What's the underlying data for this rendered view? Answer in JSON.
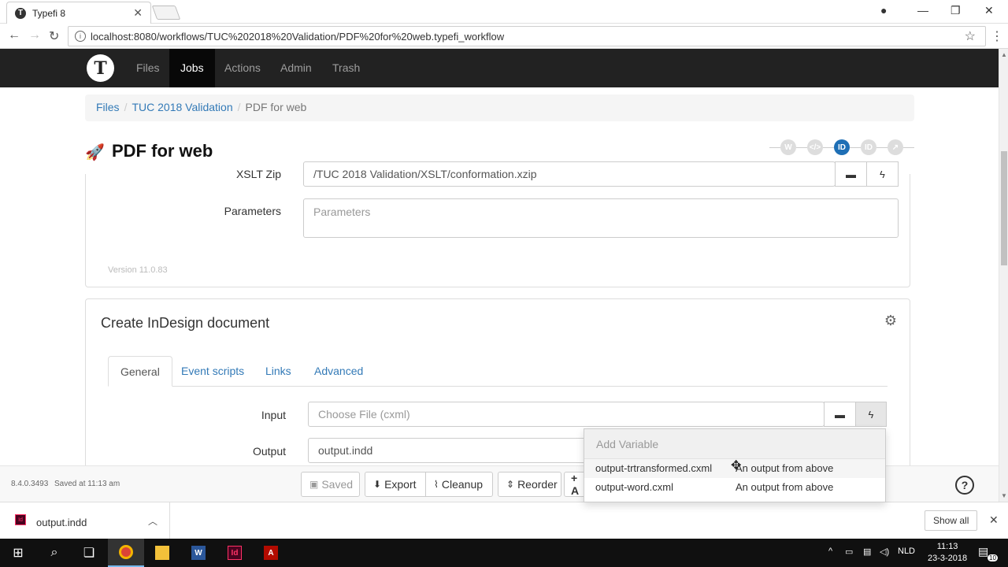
{
  "browser": {
    "tab_title": "Typefi 8",
    "url": "localhost:8080/workflows/TUC%202018%20Validation/PDF%20for%20web.typefi_workflow"
  },
  "app_nav": {
    "items": [
      {
        "label": "Files"
      },
      {
        "label": "Jobs"
      },
      {
        "label": "Actions"
      },
      {
        "label": "Admin"
      },
      {
        "label": "Trash"
      }
    ],
    "active": "Jobs"
  },
  "breadcrumb": {
    "items": [
      {
        "label": "Files"
      },
      {
        "label": "TUC 2018 Validation"
      },
      {
        "label": "PDF for web"
      }
    ]
  },
  "page": {
    "title": "PDF for web",
    "steps": [
      "W",
      "</>",
      "ID",
      "ID",
      "↗"
    ]
  },
  "panel1": {
    "xslt_label": "XSLT Zip",
    "xslt_value": "/TUC 2018 Validation/XSLT/conformation.xzip",
    "params_label": "Parameters",
    "params_placeholder": "Parameters",
    "version": "Version 11.0.83"
  },
  "panel2": {
    "title": "Create InDesign document",
    "tabs": [
      {
        "label": "General"
      },
      {
        "label": "Event scripts"
      },
      {
        "label": "Links"
      },
      {
        "label": "Advanced"
      }
    ],
    "input_label": "Input",
    "input_placeholder": "Choose File  (cxml)",
    "output_label": "Output",
    "output_value": "output.indd"
  },
  "dropdown": {
    "header": "Add Variable",
    "rows": [
      {
        "name": "output-trtransformed.cxml",
        "desc": "An output from above"
      },
      {
        "name": "output-word.cxml",
        "desc": "An output from above"
      }
    ]
  },
  "footer": {
    "version": "8.4.0.3493",
    "saved_at": "Saved at 11:13 am",
    "buttons": {
      "saved": "Saved",
      "export": "Export",
      "cleanup": "Cleanup",
      "reorder": "Reorder",
      "add": "+ A"
    }
  },
  "downloads": {
    "file": "output.indd",
    "show_all": "Show all"
  },
  "taskbar": {
    "lang": "NLD",
    "time": "11:13",
    "date": "23-3-2018",
    "notifications": "10"
  },
  "colors": {
    "navbar": "#222222",
    "link": "#337ab7",
    "step_active": "#1e6fb5"
  }
}
